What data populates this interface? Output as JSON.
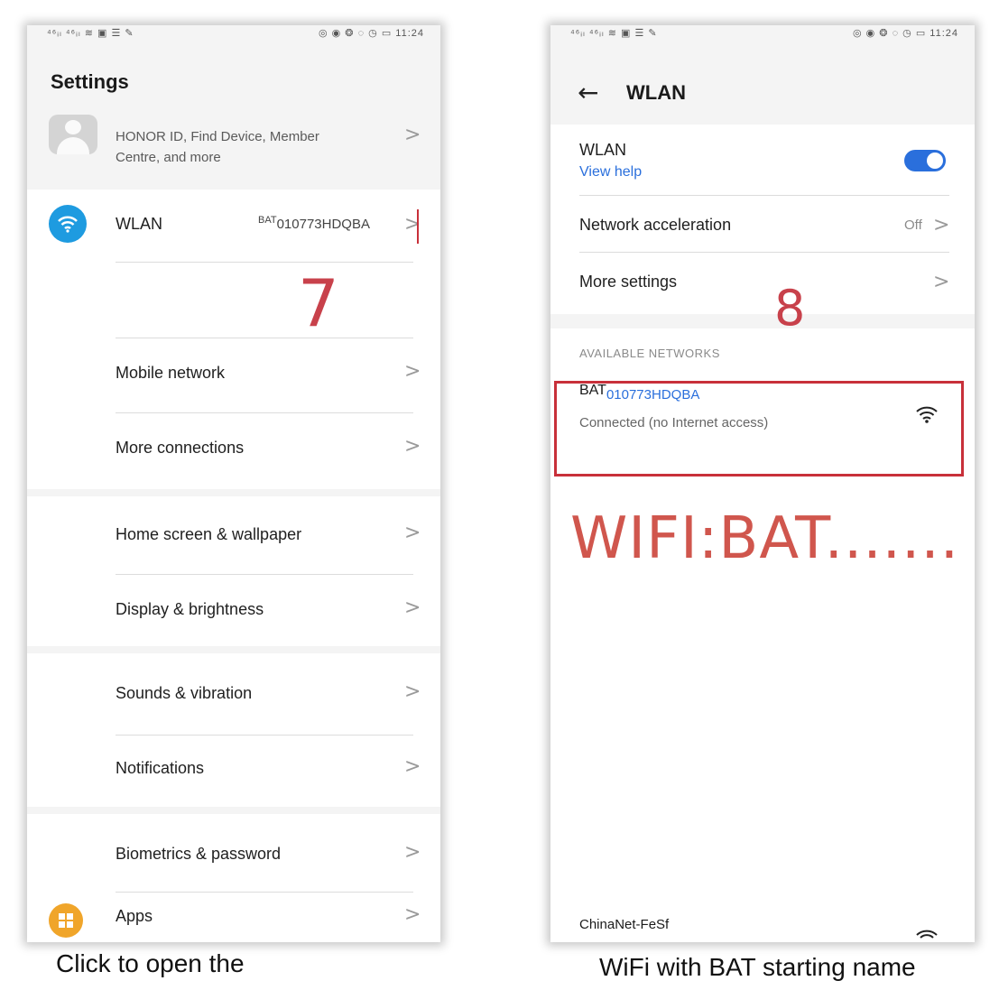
{
  "left_screen": {
    "status_left": "⁴⁶ᵢₗ ⁴⁶ᵢₗ ≋ ▣ ☰ ✎",
    "status_right": "◎ ◉ ❂ ◌ ◷ ▭ 11:24",
    "title": "Settings",
    "account_text_line1": "HONOR ID, Find Device, Member",
    "account_text_line2": "Centre, and more",
    "wlan_label": "WLAN",
    "wlan_value_prefix": "BAT",
    "wlan_value_suffix": "010773HDQBA",
    "step_number": "7",
    "items": [
      {
        "label": "Mobile network"
      },
      {
        "label": "More connections"
      },
      {
        "label": "Home screen & wallpaper"
      },
      {
        "label": "Display & brightness"
      },
      {
        "label": "Sounds & vibration"
      },
      {
        "label": "Notifications"
      },
      {
        "label": "Biometrics & password"
      },
      {
        "label": "Apps"
      }
    ],
    "chevron": ">"
  },
  "right_screen": {
    "status_left": "⁴⁶ᵢₗ ⁴⁶ᵢₗ ≋ ▣ ☰ ✎",
    "status_right": "◎ ◉ ❂ ◌ ◷ ▭ 11:24",
    "back_arrow": "←",
    "title": "WLAN",
    "wlan_label": "WLAN",
    "view_help": "View help",
    "wlan_enabled": true,
    "network_acceleration_label": "Network acceleration",
    "network_acceleration_value": "Off",
    "more_settings_label": "More settings",
    "step_number": "8",
    "available_networks_header": "AVAILABLE NETWORKS",
    "network_name_prefix": "BAT",
    "network_name_suffix": "010773HDQBA",
    "network_status": "Connected (no Internet access)",
    "annotation": "WIFI:BAT.......",
    "other_network": "ChinaNet-FeSf",
    "chevron": ">"
  },
  "captions": {
    "left": "Click to open the",
    "right": "WiFi with BAT starting  name"
  },
  "colors": {
    "accent_blue": "#2a6fdc",
    "annotation_red": "#c8414b",
    "wifi_icon_bg": "#1e9be0",
    "apps_icon_bg": "#f0a52a"
  }
}
